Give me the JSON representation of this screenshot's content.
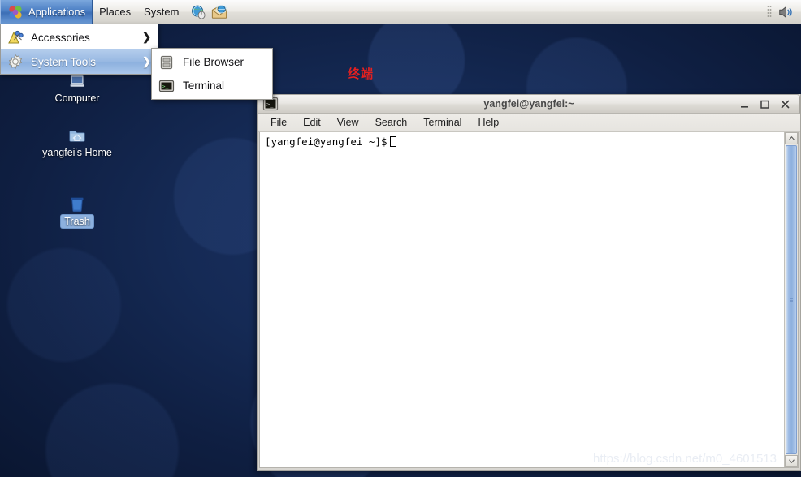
{
  "panel": {
    "applications_label": "Applications",
    "places_label": "Places",
    "system_label": "System",
    "launchers": [
      {
        "name": "web-browser-icon",
        "title": "Web Browser"
      },
      {
        "name": "email-icon",
        "title": "Email"
      }
    ],
    "tray": {
      "volume_icon": "volume-icon"
    }
  },
  "app_menu": {
    "items": [
      {
        "label": "Accessories",
        "icon": "accessories-icon",
        "has_submenu": true,
        "arrow": "❯",
        "selected": false
      },
      {
        "label": "System Tools",
        "icon": "system-tools-gear-icon",
        "has_submenu": true,
        "arrow": "❯",
        "selected": true
      }
    ]
  },
  "sub_menu": {
    "items": [
      {
        "label": "File Browser",
        "icon": "file-browser-icon"
      },
      {
        "label": "Terminal",
        "icon": "terminal-icon"
      }
    ]
  },
  "desktop": {
    "icons": [
      {
        "label": "Computer",
        "name": "desktop-icon-computer",
        "selected": false
      },
      {
        "label": "yangfei's Home",
        "name": "desktop-icon-home",
        "selected": false
      },
      {
        "label": "Trash",
        "name": "desktop-icon-trash",
        "selected": true
      }
    ],
    "annotation": "终端",
    "annotation_color": "#e8201f"
  },
  "terminal": {
    "title": "yangfei@yangfei:~",
    "menu": [
      "File",
      "Edit",
      "View",
      "Search",
      "Terminal",
      "Help"
    ],
    "window_buttons": {
      "minimize": "—",
      "maximize": "☐",
      "close": "✕"
    },
    "prompt": "[yangfei@yangfei ~]$",
    "scrollbar": {
      "up_arrow": "▲",
      "down_arrow": "▼"
    }
  },
  "watermark": "https://blog.csdn.net/m0_4601513"
}
